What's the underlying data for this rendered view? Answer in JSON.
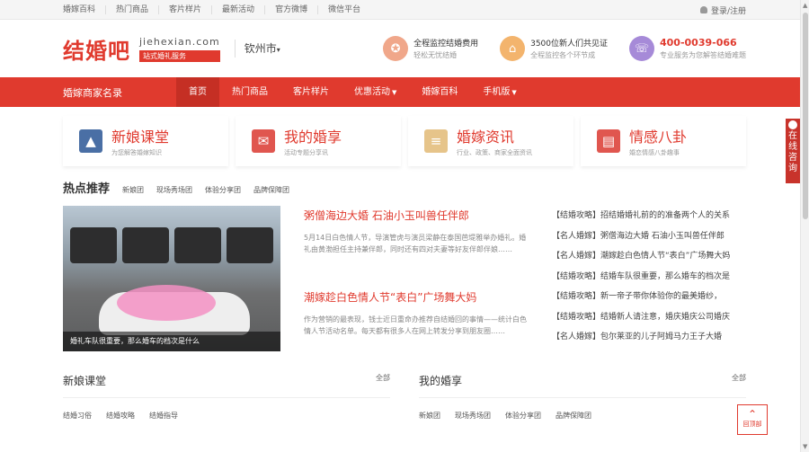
{
  "topbar": {
    "links": [
      "婚嫁百科",
      "热门商品",
      "客片样片",
      "最新活动",
      "官方微博",
      "微信平台"
    ],
    "login": "登录/注册"
  },
  "header": {
    "logo_text": "结婚吧",
    "domain": "jiehexian.com",
    "slogan": "站式婚礼服务",
    "city": "钦州市",
    "promos": [
      {
        "title": "全程监控结婚费用",
        "sub": "轻松无忧结婚",
        "icon": "medal-icon",
        "color": "#f0a78a"
      },
      {
        "title": "3500位新人们共见证",
        "sub": "全程监控各个环节成",
        "icon": "shop-icon",
        "color": "#f3b46d"
      },
      {
        "title": "400-0039-066",
        "sub": "专业服务为您解答结婚难题",
        "icon": "phone-icon",
        "color": "#a68ad8"
      }
    ]
  },
  "nav": {
    "brand": "婚嫁商家名录",
    "items": [
      {
        "label": "首页",
        "active": true,
        "dropdown": false
      },
      {
        "label": "热门商品",
        "active": false,
        "dropdown": false
      },
      {
        "label": "客片样片",
        "active": false,
        "dropdown": false
      },
      {
        "label": "优惠活动",
        "active": false,
        "dropdown": true
      },
      {
        "label": "婚嫁百科",
        "active": false,
        "dropdown": false
      },
      {
        "label": "手机版",
        "active": false,
        "dropdown": true
      }
    ]
  },
  "categories": [
    {
      "title": "新娘课堂",
      "sub": "为您解答婚嫁知识",
      "icon": "mountain-icon",
      "color": "#4a6fa5"
    },
    {
      "title": "我的婚享",
      "sub": "活动专题分享讯",
      "icon": "mail-icon",
      "color": "#e0564f"
    },
    {
      "title": "婚嫁资讯",
      "sub": "行业、政策、商家全面资讯",
      "icon": "note-icon",
      "color": "#e6c48a"
    },
    {
      "title": "情感八卦",
      "sub": "婚恋情感八卦趣事",
      "icon": "book-icon",
      "color": "#e0564f"
    }
  ],
  "hot": {
    "heading": "热点推荐",
    "tabs": [
      "新娘团",
      "现场秀场团",
      "体验分享团",
      "品牌保障团"
    ],
    "image_caption": "婚礼车队很重要，那么婚车的档次是什么",
    "articles": [
      {
        "title": "粥僧海边大婚 石油小玉叫兽任伴郎",
        "desc": "5月14日白色情人节，导演管虎与演员梁静在泰国芭堤雅举办婚礼。婚礼由黄渤担任主持兼伴郎，同时还有四对夫妻等好友伴郎伴娘……"
      },
      {
        "title": "潮嫁趁白色情人节“表白”广场舞大妈",
        "desc": "作为营销的最表现，钱士近日重命办推荐自结婚回的事情——统计白色情人节活动名单。每天都有很多人在网上转发分享到朋友圈……"
      }
    ],
    "list": [
      "【结婚攻略】招结婚婚礼前的的准备两个人的关系",
      "【名人婚嫁】粥僧海边大婚 石油小玉叫兽任伴郎",
      "【名人婚嫁】潮嫁趁白色情人节“表白”广场舞大妈",
      "【结婚攻略】结婚车队很重要，那么婚车的档次是",
      "【结婚攻略】新一帝子带你体验你的最美婚纱，",
      "【结婚攻略】结婚新人请注意，婚庆婚庆公司婚庆",
      "【名人婚嫁】包尔莱亚的儿子阿姆马力王子大婚"
    ]
  },
  "bottom": [
    {
      "title": "新娘课堂",
      "more": "全部",
      "tabs": [
        "结婚习俗",
        "结婚攻略",
        "结婚指导"
      ]
    },
    {
      "title": "我的婚享",
      "more": "全部",
      "tabs": [
        "新娘团",
        "现场秀场团",
        "体验分享团",
        "品牌保障团"
      ]
    }
  ],
  "side": {
    "consult": "在线咨询",
    "backtop": "回顶部"
  }
}
